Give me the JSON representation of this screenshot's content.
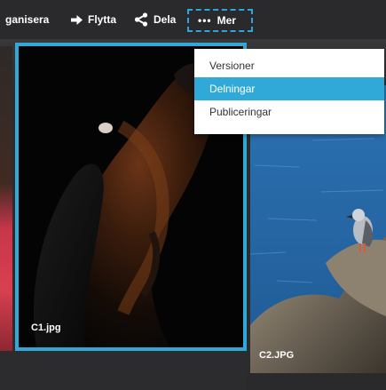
{
  "toolbar": {
    "organize_label": "ganisera",
    "move_label": "Flytta",
    "share_label": "Dela",
    "more_label": "Mer",
    "icons": {
      "move": "arrow-right-icon",
      "share": "share-icon",
      "more": "more-dots-icon"
    }
  },
  "menu": {
    "items": [
      {
        "label": "Versioner",
        "selected": false
      },
      {
        "label": "Delningar",
        "selected": true
      },
      {
        "label": "Publiceringar",
        "selected": false
      }
    ]
  },
  "gallery": {
    "items": [
      {
        "label": "C1.jpg",
        "selected": true
      },
      {
        "label": "C2.JPG",
        "selected": false
      }
    ]
  },
  "colors": {
    "accent": "#31a9d8",
    "toolbar_bg": "#2a2a2c",
    "menu_bg": "#ffffff"
  }
}
